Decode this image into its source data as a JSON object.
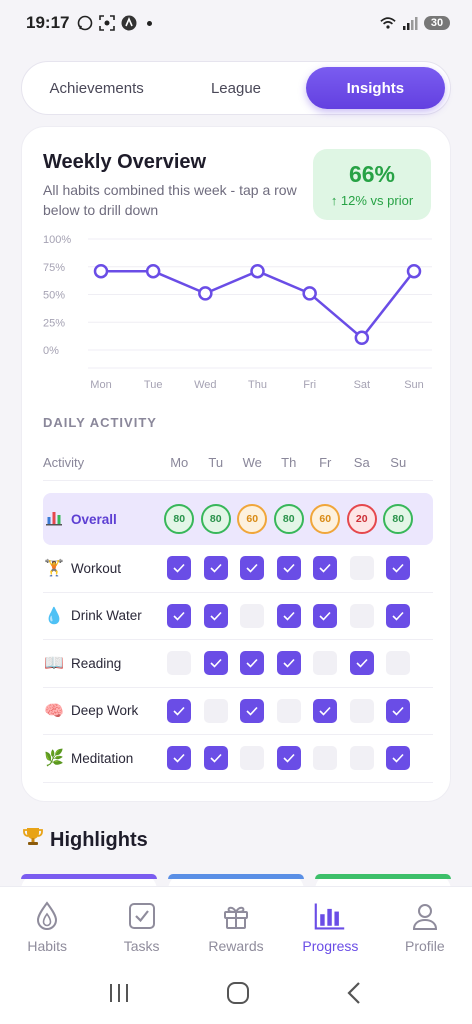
{
  "status_bar": {
    "time": "19:17",
    "battery": "30",
    "icons": [
      "whatsapp-icon",
      "screenshot-icon",
      "app-icon",
      "dot-icon",
      "wifi-icon",
      "signal-icon",
      "battery-icon"
    ]
  },
  "tabs": [
    {
      "label": "Achievements",
      "active": false
    },
    {
      "label": "League",
      "active": false
    },
    {
      "label": "Insights",
      "active": true
    }
  ],
  "weekly": {
    "title": "Weekly Overview",
    "subtitle": "All habits combined this week - tap a row below to drill down",
    "stat_value": "66%",
    "stat_delta": "↑ 12% vs prior"
  },
  "chart_data": {
    "type": "line",
    "categories": [
      "Mon",
      "Tue",
      "Wed",
      "Thu",
      "Fri",
      "Sat",
      "Sun"
    ],
    "values": [
      80,
      80,
      60,
      80,
      60,
      20,
      80
    ],
    "y_ticks": [
      "100%",
      "75%",
      "50%",
      "25%",
      "0%"
    ],
    "ylim": [
      0,
      100
    ],
    "color": "#6a4de6",
    "grid": true
  },
  "daily": {
    "section_label": "DAILY ACTIVITY",
    "header": "Activity",
    "days": [
      "Mo",
      "Tu",
      "We",
      "Th",
      "Fr",
      "Sa",
      "Su"
    ],
    "overall": {
      "label": "Overall",
      "icon": "bar-chart-emoji",
      "scores": [
        {
          "v": "80",
          "tone": "green"
        },
        {
          "v": "80",
          "tone": "green"
        },
        {
          "v": "60",
          "tone": "orange"
        },
        {
          "v": "80",
          "tone": "green"
        },
        {
          "v": "60",
          "tone": "orange"
        },
        {
          "v": "20",
          "tone": "red"
        },
        {
          "v": "80",
          "tone": "green"
        }
      ]
    },
    "habits": [
      {
        "label": "Workout",
        "emoji": "🏋",
        "icon": "weightlifter-emoji",
        "done": [
          true,
          true,
          true,
          true,
          true,
          false,
          true
        ]
      },
      {
        "label": "Drink Water",
        "emoji": "💧",
        "icon": "droplet-emoji",
        "done": [
          true,
          true,
          false,
          true,
          true,
          false,
          true
        ]
      },
      {
        "label": "Reading",
        "emoji": "📖",
        "icon": "book-emoji",
        "done": [
          false,
          true,
          true,
          true,
          false,
          true,
          false
        ]
      },
      {
        "label": "Deep Work",
        "emoji": "🧠",
        "icon": "brain-emoji",
        "done": [
          true,
          false,
          true,
          false,
          true,
          false,
          true
        ]
      },
      {
        "label": "Meditation",
        "emoji": "🌿",
        "icon": "leaf-emoji",
        "done": [
          true,
          true,
          false,
          true,
          false,
          false,
          true
        ]
      }
    ]
  },
  "highlights": {
    "title": "Highlights",
    "icon": "trophy-emoji"
  },
  "bottom_nav": [
    {
      "label": "Habits",
      "icon": "drop-icon",
      "active": false
    },
    {
      "label": "Tasks",
      "icon": "checkbox-icon",
      "active": false
    },
    {
      "label": "Rewards",
      "icon": "gift-icon",
      "active": false
    },
    {
      "label": "Progress",
      "icon": "bar-chart-icon",
      "active": true
    },
    {
      "label": "Profile",
      "icon": "person-icon",
      "active": false
    }
  ],
  "system_nav": [
    "recents-icon",
    "home-icon",
    "back-icon"
  ],
  "colors": {
    "accent": "#6a4de6",
    "success": "#27a245",
    "warning": "#f0a63a",
    "danger": "#e5484d"
  }
}
